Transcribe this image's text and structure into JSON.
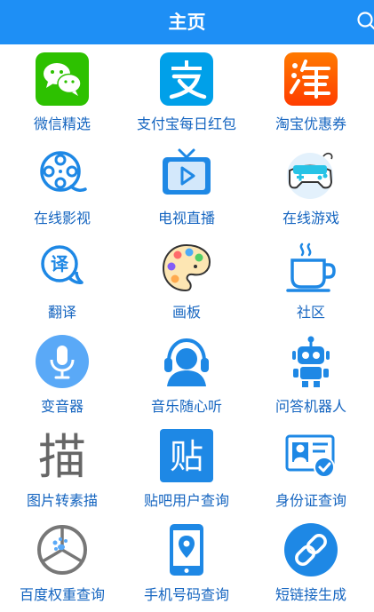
{
  "header": {
    "title": "主页"
  },
  "colors": {
    "topbar": "#1e8ff5",
    "label": "#1565c0"
  },
  "grid": [
    {
      "label": "微信精选",
      "icon": "wechat-icon"
    },
    {
      "label": "支付宝每日红包",
      "icon": "alipay-icon"
    },
    {
      "label": "淘宝优惠券",
      "icon": "taobao-icon"
    },
    {
      "label": "在线影视",
      "icon": "film-reel-icon"
    },
    {
      "label": "电视直播",
      "icon": "tv-icon"
    },
    {
      "label": "在线游戏",
      "icon": "gamepad-icon"
    },
    {
      "label": "翻译",
      "icon": "translate-icon"
    },
    {
      "label": "画板",
      "icon": "palette-icon"
    },
    {
      "label": "社区",
      "icon": "coffee-cup-icon"
    },
    {
      "label": "变音器",
      "icon": "microphone-icon"
    },
    {
      "label": "音乐随心听",
      "icon": "headphones-icon"
    },
    {
      "label": "问答机器人",
      "icon": "robot-icon"
    },
    {
      "label": "图片转素描",
      "icon": "sketch-icon",
      "glyph": "描"
    },
    {
      "label": "贴吧用户查询",
      "icon": "tieba-icon",
      "glyph": "贴"
    },
    {
      "label": "身份证查询",
      "icon": "id-card-icon"
    },
    {
      "label": "百度权重查询",
      "icon": "weight-icon"
    },
    {
      "label": "手机号码查询",
      "icon": "phone-location-icon"
    },
    {
      "label": "短链接生成",
      "icon": "link-icon"
    }
  ]
}
